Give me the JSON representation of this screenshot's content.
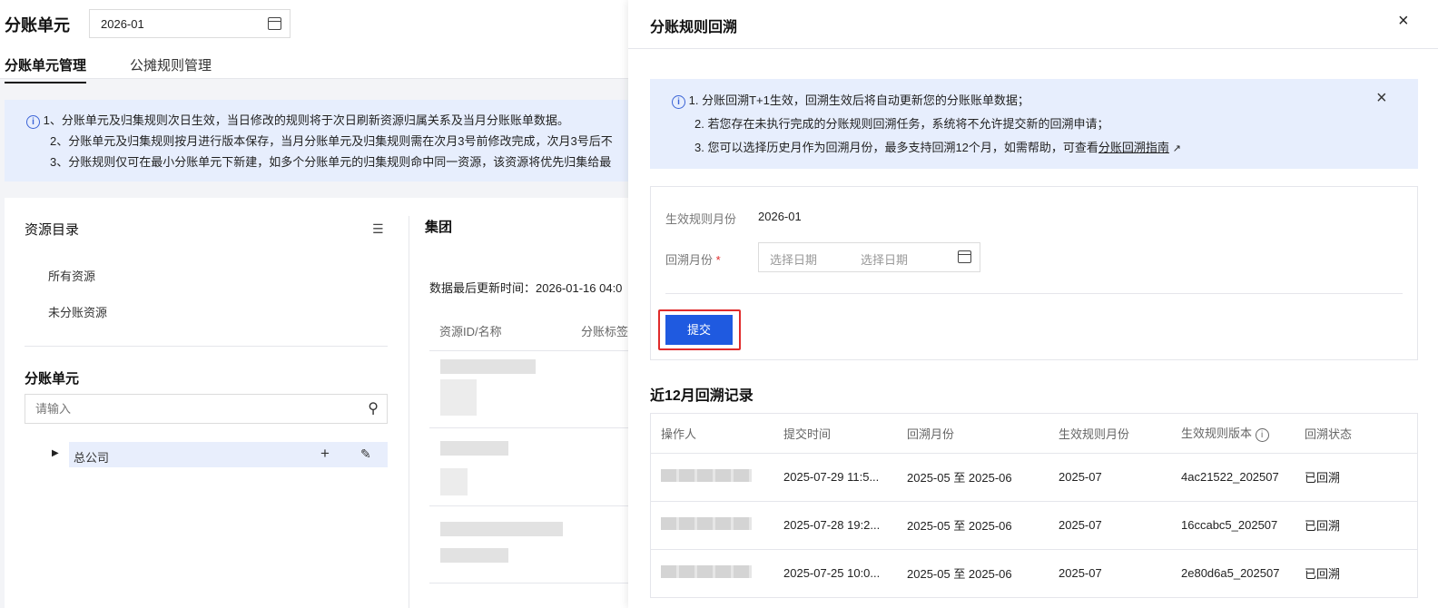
{
  "page": {
    "title": "分账单元",
    "month": "2026-01",
    "tabs": [
      {
        "label": "分账单元管理",
        "active": true
      },
      {
        "label": "公摊规则管理",
        "active": false
      }
    ],
    "notices": [
      "1、分账单元及归集规则次日生效，当日修改的规则将于次日刷新资源归属关系及当月分账账单数据。",
      "2、分账单元及归集规则按月进行版本保存，当月分账单元及归集规则需在次月3号前修改完成，次月3号后不",
      "3、分账规则仅可在最小分账单元下新建，如多个分账单元的归集规则命中同一资源，该资源将优先归集给最"
    ]
  },
  "catalog": {
    "title": "资源目录",
    "items": [
      "所有资源",
      "未分账资源"
    ],
    "unit_title": "分账单元",
    "search_placeholder": "请输入",
    "tree": [
      {
        "label": "总公司"
      }
    ]
  },
  "group": {
    "title": "集团",
    "updated": "数据最后更新时间：2026-01-16 04:0",
    "columns": [
      "资源ID/名称",
      "分账标签"
    ]
  },
  "drawer": {
    "title": "分账规则回溯",
    "notices": [
      "1. 分账回溯T+1生效，回溯生效后将自动更新您的分账账单数据；",
      "2. 若您存在未执行完成的分账规则回溯任务，系统将不允许提交新的回溯申请；",
      "3. 您可以选择历史月作为回溯月份，最多支持回溯12个月，如需帮助，可查看"
    ],
    "guide_link": "分账回溯指南",
    "form": {
      "effective_label": "生效规则月份",
      "effective_value": "2026-01",
      "backtrack_label": "回溯月份",
      "required_mark": "*",
      "start_placeholder": "选择日期",
      "end_placeholder": "选择日期",
      "submit": "提交"
    },
    "records_title": "近12月回溯记录",
    "columns": [
      "操作人",
      "提交时间",
      "回溯月份",
      "生效规则月份",
      "生效规则版本",
      "回溯状态"
    ],
    "rows": [
      {
        "time": "2025-07-29 11:5...",
        "range": "2025-05 至 2025-06",
        "month": "2025-07",
        "version": "4ac21522_202507",
        "status": "已回溯"
      },
      {
        "time": "2025-07-28 19:2...",
        "range": "2025-05 至 2025-06",
        "month": "2025-07",
        "version": "16ccabc5_202507",
        "status": "已回溯"
      },
      {
        "time": "2025-07-25 10:0...",
        "range": "2025-05 至 2025-06",
        "month": "2025-07",
        "version": "2e80d6a5_202507",
        "status": "已回溯"
      }
    ]
  },
  "colors": {
    "accent": "#1f5ae0",
    "banner": "#e7eefd",
    "highlight": "#e8eefc",
    "outline": "#e02b2b"
  }
}
